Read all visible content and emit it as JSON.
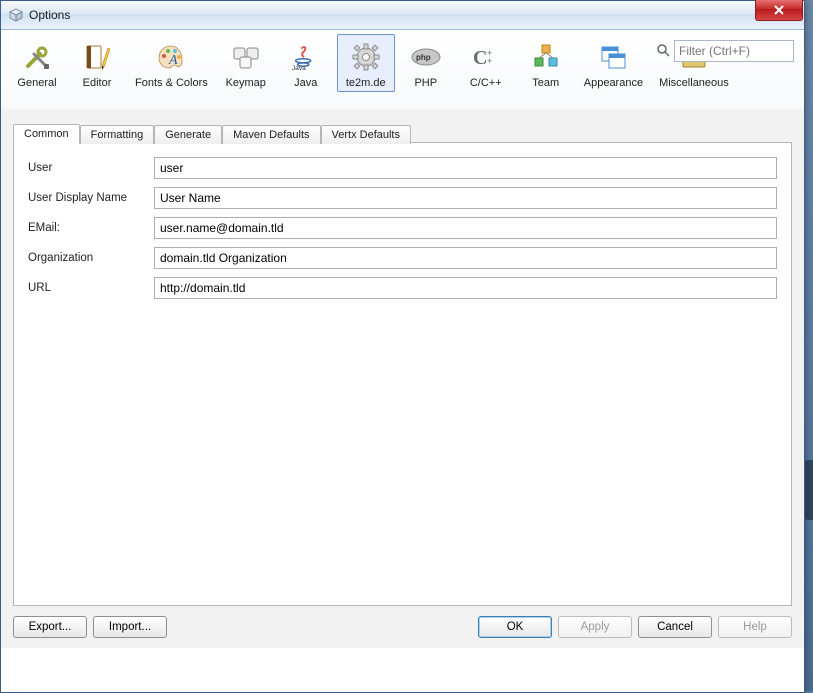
{
  "window": {
    "title": "Options"
  },
  "filter": {
    "placeholder": "Filter (Ctrl+F)"
  },
  "categories": [
    {
      "id": "general",
      "label": "General"
    },
    {
      "id": "editor",
      "label": "Editor"
    },
    {
      "id": "fonts-colors",
      "label": "Fonts & Colors"
    },
    {
      "id": "keymap",
      "label": "Keymap"
    },
    {
      "id": "java",
      "label": "Java"
    },
    {
      "id": "te2m",
      "label": "te2m.de",
      "selected": true
    },
    {
      "id": "php",
      "label": "PHP"
    },
    {
      "id": "c-cpp",
      "label": "C/C++"
    },
    {
      "id": "team",
      "label": "Team"
    },
    {
      "id": "appearance",
      "label": "Appearance"
    },
    {
      "id": "miscellaneous",
      "label": "Miscellaneous"
    }
  ],
  "tabs": [
    {
      "id": "common",
      "label": "Common",
      "active": true
    },
    {
      "id": "formatting",
      "label": "Formatting"
    },
    {
      "id": "generate",
      "label": "Generate"
    },
    {
      "id": "maven-defaults",
      "label": "Maven Defaults"
    },
    {
      "id": "vertx-defaults",
      "label": "Vertx Defaults"
    }
  ],
  "form": {
    "user": {
      "label": "User",
      "value": "user"
    },
    "userDisplayName": {
      "label": "User Display Name",
      "value": "User Name"
    },
    "email": {
      "label": "EMail:",
      "value": "user.name@domain.tld"
    },
    "organization": {
      "label": "Organization",
      "value": "domain.tld Organization"
    },
    "url": {
      "label": "URL",
      "value": "http://domain.tld"
    }
  },
  "buttons": {
    "export": "Export...",
    "import": "Import...",
    "ok": "OK",
    "apply": "Apply",
    "cancel": "Cancel",
    "help": "Help"
  }
}
